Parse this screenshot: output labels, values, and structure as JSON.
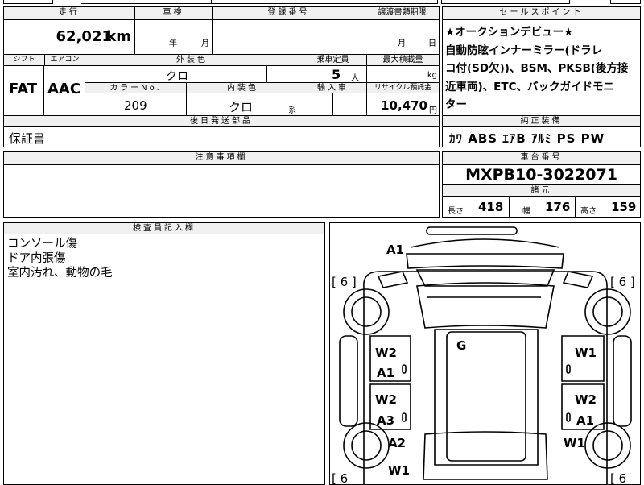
{
  "top_strip": {
    "partial_text": "■ ■ ■"
  },
  "row1": {
    "mileage_label": "走行",
    "mileage_value": "62,021",
    "mileage_unit": "km",
    "inspection_label": "車検",
    "inspection_year": "年",
    "inspection_month": "月",
    "registration_label": "登録番号",
    "registration_value": "",
    "transfer_label": "譲渡書類期限",
    "transfer_month": "月",
    "transfer_day": "日"
  },
  "row2": {
    "shift_label": "シフト",
    "shift_value": "FAT",
    "ac_label": "エアコン",
    "ac_value": "AAC",
    "exterior_label": "外装色",
    "exterior_value": "クロ",
    "capacity_label": "乗車定員",
    "capacity_value": "5",
    "capacity_unit": "人",
    "load_label": "最大積載量",
    "load_unit": "kg",
    "color_no_label": "カラーNo.",
    "color_no_value": "209",
    "interior_label": "内装色",
    "interior_value": "クロ",
    "interior_suffix": "系",
    "import_label": "輸入車",
    "recycle_label": "リサイクル預託金",
    "recycle_value": "10,470",
    "recycle_unit": "円"
  },
  "parts": {
    "label": "後日発送部品",
    "value": "保証書"
  },
  "notes": {
    "label": "注意事項欄",
    "value": ""
  },
  "sales_point": {
    "label": "セールスポイント",
    "lines": [
      "★オークションデビュー★",
      "自動防眩インナーミラー(ドラレ",
      "コ付(SD欠))、BSM、PKSB(後方接",
      "近車両)、ETC、バックガイドモニ",
      "ター"
    ]
  },
  "equipment": {
    "label": "純正装備",
    "value": "ｶﾜ ABS ｴｱB ｱﾙﾐ PS PW"
  },
  "chassis": {
    "label": "車台番号",
    "value": "MXPB10-3022071"
  },
  "specs": {
    "label": "諸元",
    "length_label": "長さ",
    "length_value": "418",
    "width_label": "幅",
    "width_value": "176",
    "height_label": "高さ",
    "height_value": "159"
  },
  "inspector": {
    "label": "検査員記入欄",
    "lines": [
      "コンソール傷",
      "ドア内張傷",
      "室内汚れ、動物の毛"
    ]
  },
  "diagram": {
    "tire_marks": [
      "[ 6 ]",
      "[ 6 ]",
      "[ 6",
      "[ 6"
    ],
    "marks": [
      "A1",
      "G",
      "W2",
      "A1",
      "W1",
      "W2",
      "A3",
      "W2",
      "A1",
      "A2",
      "W1",
      "W1"
    ]
  }
}
